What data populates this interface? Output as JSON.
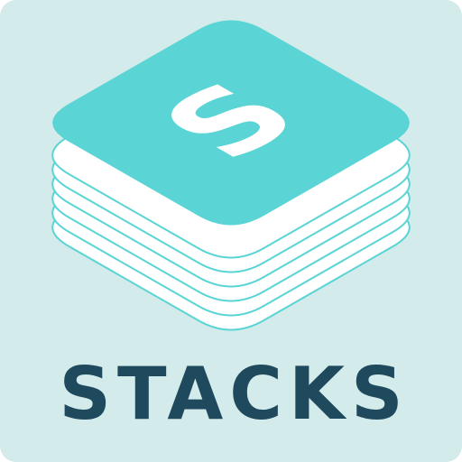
{
  "app": {
    "name": "STACKS",
    "monogram": "S"
  },
  "colors": {
    "background": "#d3ebea",
    "accent": "#5ad4d4",
    "layer_fill": "#ffffff",
    "layer_stroke": "#5ad4d4",
    "wordmark": "#1f4a5e",
    "monogram": "#ffffff"
  },
  "icons": {
    "logo": "stacked-layers-icon"
  }
}
